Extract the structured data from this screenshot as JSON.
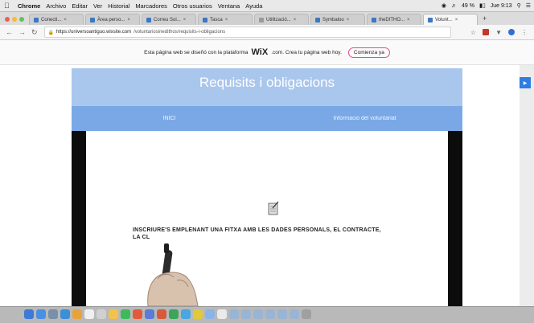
{
  "menubar": {
    "app_name": "Chrome",
    "items": [
      "Archivo",
      "Editar",
      "Ver",
      "Historial",
      "Marcadores",
      "Otros usuarios",
      "Ventana",
      "Ayuda"
    ],
    "battery": "49 %",
    "clock": "Jue 9:13"
  },
  "tabs": [
    {
      "label": "Conecti..."
    },
    {
      "label": "Àrea perso..."
    },
    {
      "label": "Correu Sol..."
    },
    {
      "label": "Tasca"
    },
    {
      "label": "Utilització..."
    },
    {
      "label": "Symbaloo"
    },
    {
      "label": "theDITHO..."
    },
    {
      "label": "Volunt..."
    }
  ],
  "address_bar": {
    "url_domain": "https://universoantiguo.wixsite.com",
    "url_path": "/voluntariosinedithos/requisits-i-obligacions"
  },
  "wix_banner": {
    "text": "Esta página web se diseñó con la plataforma",
    "brand": "WiX",
    "brand_suffix": ".com. Crea tu página web hoy.",
    "button_label": "Comienza ya"
  },
  "site": {
    "title": "Requisits i obligacions",
    "nav": [
      "INICI",
      "Informació del voluntariat"
    ]
  },
  "video": {
    "caption_line1": "INSCRIURE'S EMPLENANT UNA FITXA AMB LES DADES PERSONALS, EL CONTRACTE,",
    "caption_line2": "LA CL"
  },
  "colors": {
    "header_bg": "#a9c6ed",
    "nav_bg": "#7aa8e6",
    "wix_button_border": "#e24b8b"
  }
}
